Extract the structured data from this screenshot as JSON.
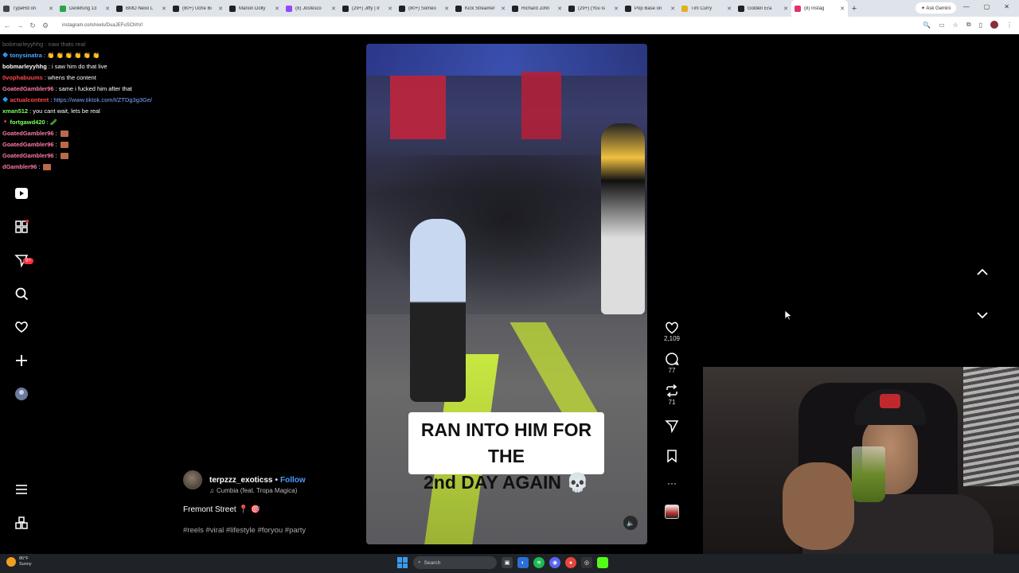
{
  "browser": {
    "tabs": [
      {
        "label": "TypeRd on",
        "color": "#444444"
      },
      {
        "label": "DenkKing 13",
        "color": "#2aa44a"
      },
      {
        "label": "BMO Nexo L",
        "color": "#222222"
      },
      {
        "label": "(80+) Uche Bi",
        "color": "#222222"
      },
      {
        "label": "Marion Dolly",
        "color": "#222222"
      },
      {
        "label": "(8) Josfesco",
        "color": "#9146ff"
      },
      {
        "label": "(29+) Jiffy | Ir",
        "color": "#222222"
      },
      {
        "label": "(80+) Someo",
        "color": "#222222"
      },
      {
        "label": "Kick Streamer",
        "color": "#222222"
      },
      {
        "label": "Richard John",
        "color": "#222222"
      },
      {
        "label": "(29+) (You is",
        "color": "#222222"
      },
      {
        "label": "Pop Base on",
        "color": "#222222"
      },
      {
        "label": "Tim Curry",
        "color": "#e0b020"
      },
      {
        "label": "Golden Era",
        "color": "#222222"
      },
      {
        "label": "(8) Instag",
        "color": "#e1306c",
        "active": true
      }
    ],
    "new_tab": "+",
    "gemini_label": "✦ Ask Gemini",
    "window_controls": [
      "—",
      "▢",
      "✕"
    ],
    "url": "instagram.com/reels/DuaJEFuSChhV/"
  },
  "chat": {
    "faded_line": "bobmarleyyhhg : naw thats real",
    "messages": [
      {
        "user": "tonysinatra",
        "color": "#4ea8ff",
        "msg": "👏 👏 👏 👏 👏 👏",
        "badge": "🔷"
      },
      {
        "user": "bobmarleyyhhg",
        "color": "#ffffff",
        "msg": "i saw him do that live",
        "badge": ""
      },
      {
        "user": "0vophabuums",
        "color": "#ff4a4a",
        "msg": "whens the content",
        "badge": ""
      },
      {
        "user": "GoatedGambler96",
        "color": "#ff7aa8",
        "msg": "same i fucked him after that",
        "badge": ""
      },
      {
        "user": "actualcontent",
        "color": "#ff4a4a",
        "msg": "https://www.tiktok.com/t/ZTDg3g3Ge/",
        "badge": "🔷",
        "link": true
      },
      {
        "user": "xman512",
        "color": "#7dff5a",
        "msg": "you cant wait, lets be real",
        "badge": ""
      },
      {
        "user": "fortgawd420",
        "color": "#7dff5a",
        "msg": "🥒",
        "badge": "🔻"
      },
      {
        "user": "GoatedGambler96",
        "color": "#ff7aa8",
        "msg": "",
        "badge": "",
        "emote": true
      },
      {
        "user": "GoatedGambler96",
        "color": "#ff7aa8",
        "msg": "",
        "badge": "",
        "emote": true
      },
      {
        "user": "GoatedGambler96",
        "color": "#ff7aa8",
        "msg": "",
        "badge": "",
        "emote": true
      },
      {
        "user": "dGambler96",
        "color": "#ff7aa8",
        "msg": "",
        "badge": "",
        "emote": true
      }
    ]
  },
  "rail": {
    "icons": [
      "reels-icon",
      "apps-icon",
      "messages-icon",
      "search-icon",
      "heart-icon",
      "create-icon",
      "profile-icon",
      "more-icon",
      "also-from-meta-icon"
    ],
    "messages_badge": "9+"
  },
  "reel": {
    "caption_line1": "RAN INTO HIM FOR THE",
    "caption_line2": "2nd DAY AGAIN 💀",
    "author": "terpzzz_exoticss",
    "follow": "Follow",
    "audio": "Cumbia (feat. Tropa Magica)",
    "title": "Fremont Street 📍 🎯",
    "tags": "#reels #viral #lifestyle #foryou #party"
  },
  "actions": {
    "likes": "2,109",
    "comments": "77",
    "reposts": "71"
  },
  "taskbar": {
    "weather_temp": "86°F",
    "weather_desc": "Sunny",
    "search_placeholder": "Search"
  }
}
